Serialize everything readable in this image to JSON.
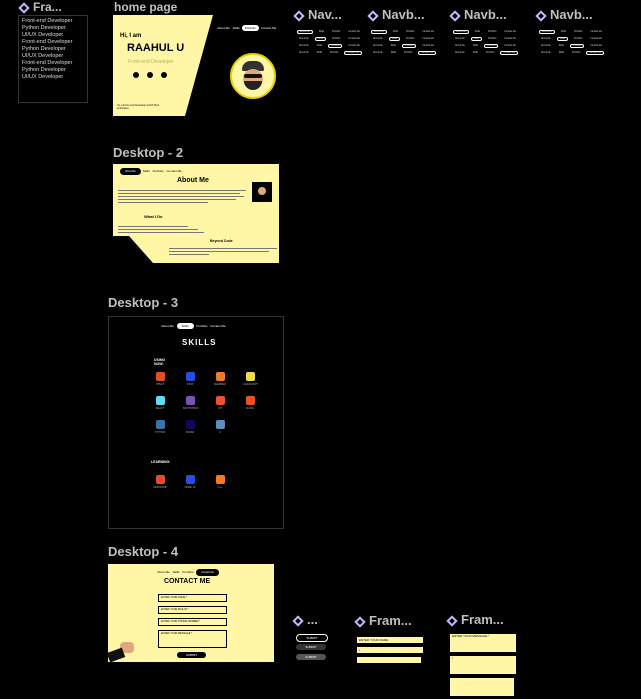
{
  "frame1": {
    "label": "Fra...",
    "items": [
      "Front-end Developer",
      "Python Developer",
      "UI/UX Developer",
      "Front-end Developer",
      "Python Developer",
      "UI/UX Developer",
      "Front-end Developer",
      "Python Developer",
      "UI/UX Developer"
    ]
  },
  "home": {
    "label": "home page",
    "greeting": "Hi, I am",
    "name": "RAAHUL U",
    "role": "Front-end Developer",
    "nav": [
      "About Me",
      "Skills",
      "Portfolio",
      "Contact Me"
    ],
    "tagline": "I'm a Front-end Developer and Python enthusiast."
  },
  "desktop2": {
    "label": "Desktop - 2",
    "nav": [
      "About Me",
      "Skills",
      "Portfolio",
      "Contact Me"
    ],
    "title": "About Me",
    "what_i_do": "What I Do",
    "beyond": "Beyond Code"
  },
  "desktop3": {
    "label": "Desktop - 3",
    "nav": [
      "About Me",
      "Skills",
      "Portfolio",
      "Contact Me"
    ],
    "title": "SKILLS",
    "using_now": "USING NOW:",
    "learning": "LEARNING:",
    "skills_row1": [
      "HTML5",
      "CSS3",
      "BLENDER",
      "JAVASCRIPT"
    ],
    "skills_row2": [
      "REACT",
      "BOOTSTRAP",
      "GIT",
      "FIGMA"
    ],
    "skills_row3": [
      "PYTHON",
      "PANDA",
      "C"
    ],
    "learning_row": [
      "MONGODB",
      "NODE JS",
      "C++"
    ]
  },
  "desktop4": {
    "label": "Desktop - 4",
    "nav": [
      "About Me",
      "Skills",
      "Portfolio",
      "Contact Me"
    ],
    "title": "CONTACT ME",
    "name_field": "ENTER YOUR NAME *",
    "email_field": "ENTER YOUR MAIL ID *",
    "phone_field": "ENTER YOUR PHONE NUMBER *",
    "message_field": "ENTER YOUR MESSAGE *",
    "submit": "SUBMIT"
  },
  "navs": [
    {
      "label": "Nav..."
    },
    {
      "label": "Navb..."
    },
    {
      "label": "Navb..."
    },
    {
      "label": "Navb..."
    }
  ],
  "nav_items": [
    "About Me",
    "Skills",
    "Portfolio",
    "Contact Me"
  ],
  "button_frame": {
    "label": "...",
    "buttons": [
      "SUBMIT",
      "SUBMIT",
      "SUBMIT"
    ]
  },
  "input_frame": {
    "label": "Fram...",
    "field1": "ENTER YOUR NAME"
  },
  "input_frame2": {
    "label": "Fram...",
    "field1": "ENTER YOUR MESSAGE *"
  },
  "colors": {
    "accent_yellow": "#fff7a6",
    "frame_label": "#bfbfbf",
    "icon_purple": "#c9b7ff"
  }
}
